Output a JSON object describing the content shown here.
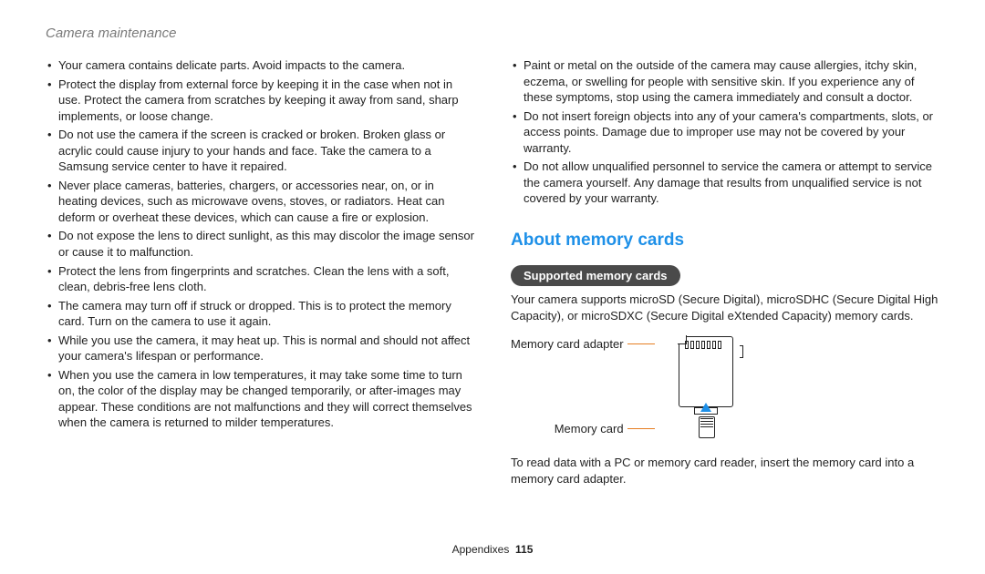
{
  "header": {
    "title": "Camera maintenance"
  },
  "left_bullets": [
    "Your camera contains delicate parts. Avoid impacts to the camera.",
    "Protect the display from external force by keeping it in the case when not in use. Protect the camera from scratches by keeping it away from sand, sharp implements, or loose change.",
    "Do not use the camera if the screen is cracked or broken. Broken glass or acrylic could cause injury to your hands and face. Take the camera to a Samsung service center to have it repaired.",
    "Never place cameras, batteries, chargers, or accessories near, on, or in heating devices, such as microwave ovens, stoves, or radiators. Heat can deform or overheat these devices, which can cause a fire or explosion.",
    "Do not expose the lens to direct sunlight, as this may discolor the image sensor or cause it to malfunction.",
    "Protect the lens from fingerprints and scratches. Clean the lens with a soft, clean, debris-free lens cloth.",
    "The camera may turn off if struck or dropped. This is to protect the memory card. Turn on the camera to use it again.",
    "While you use the camera, it may heat up. This is normal and should not affect your camera's lifespan or performance.",
    "When you use the camera in low temperatures, it may take some time to turn on, the color of the display may be changed temporarily, or after-images may appear. These conditions are not malfunctions and they will correct themselves when the camera is returned to milder temperatures."
  ],
  "right_bullets": [
    "Paint or metal on the outside of the camera may cause allergies, itchy skin, eczema, or swelling for people with sensitive skin. If you experience any of these symptoms, stop using the camera immediately and consult a doctor.",
    "Do not insert foreign objects into any of your camera's compartments, slots, or access points. Damage due to improper use may not be covered by your warranty.",
    "Do not allow unqualified personnel to service the camera or attempt to service the camera yourself. Any damage that results from unqualified service is not covered by your warranty."
  ],
  "memory_section": {
    "title": "About memory cards",
    "supported_label": "Supported memory cards",
    "supported_text": "Your camera supports microSD (Secure Digital), microSDHC (Secure Digital High Capacity), or microSDXC (Secure Digital eXtended Capacity) memory cards.",
    "adapter_label": "Memory card adapter",
    "card_label": "Memory card",
    "footer_text": "To read data with a PC or memory card reader, insert the memory card into a memory card adapter."
  },
  "footer": {
    "section": "Appendixes",
    "page": "115"
  }
}
